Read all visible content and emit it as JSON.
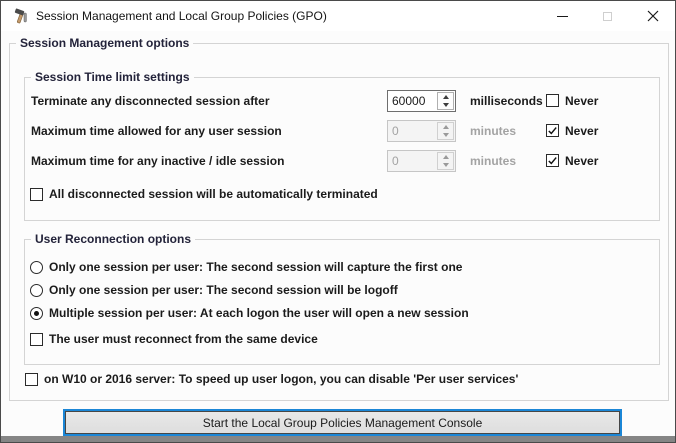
{
  "window": {
    "title": "Session Management and Local Group Policies (GPO)",
    "icon": "hammer-tools-icon"
  },
  "outer_group": {
    "label": "Session Management options"
  },
  "time_limits": {
    "label": "Session Time limit settings",
    "rows": [
      {
        "label": "Terminate any disconnected session after",
        "value": "60000",
        "unit": "milliseconds",
        "never_label": "Never",
        "never_checked": false,
        "enabled": true
      },
      {
        "label": "Maximum time allowed for any user session",
        "value": "0",
        "unit": "minutes",
        "never_label": "Never",
        "never_checked": true,
        "enabled": false
      },
      {
        "label": "Maximum time for any inactive / idle session",
        "value": "0",
        "unit": "minutes",
        "never_label": "Never",
        "never_checked": true,
        "enabled": false
      }
    ],
    "auto_terminate_label": "All disconnected session will be automatically terminated",
    "auto_terminate_checked": false
  },
  "reconnection": {
    "label": "User Reconnection options",
    "options": [
      {
        "label": "Only one session per user: The second session will capture the first one",
        "selected": false
      },
      {
        "label": "Only one session per user: The second session will be logoff",
        "selected": false
      },
      {
        "label": "Multiple session per user: At each logon the user will open a new session",
        "selected": true
      }
    ],
    "same_device_label": "The user must reconnect from the same device",
    "same_device_checked": false
  },
  "per_user_services": {
    "label": "on W10 or 2016 server: To speed up user logon, you can disable 'Per user services'",
    "checked": false
  },
  "start_button_label": "Start the Local Group Policies Management Console",
  "colors": {
    "accent_blue": "#1b86d6",
    "disabled_text": "#a3a3a3",
    "group_border": "#d4d4d4",
    "bottom_strip": "#858585"
  }
}
